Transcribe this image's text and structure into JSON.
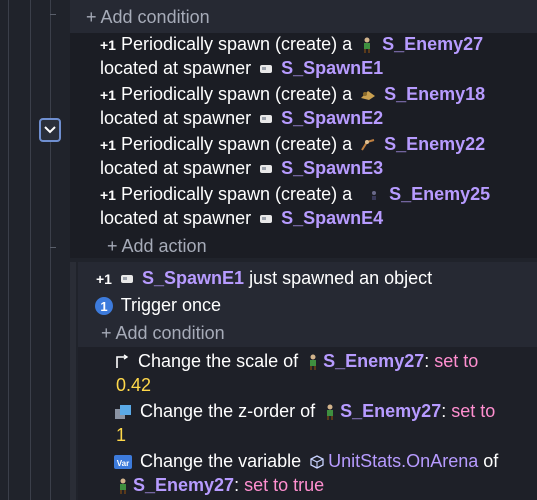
{
  "add_condition_label": "+ Add condition",
  "add_action_label": "+ Add action",
  "plus_one": "+1",
  "spawn_actions": [
    {
      "text": "Periodically spawn (create) a",
      "object": "S_Enemy27",
      "located": "located at spawner",
      "spawner": "S_SpawnE1"
    },
    {
      "text": "Periodically spawn (create) a",
      "object": "S_Enemy18",
      "located": "located at spawner",
      "spawner": "S_SpawnE2"
    },
    {
      "text": "Periodically spawn (create) a",
      "object": "S_Enemy22",
      "located": "located at spawner",
      "spawner": "S_SpawnE3"
    },
    {
      "text": "Periodically spawn (create) a",
      "object": "S_Enemy25",
      "located": "located at spawner",
      "spawner": "S_SpawnE4"
    }
  ],
  "sub_event": {
    "trigger_object": "S_SpawnE1",
    "trigger_text": "just spawned an object",
    "trigger_once_label": "Trigger once",
    "actions": [
      {
        "prefix": "Change the scale of",
        "object": "S_Enemy27",
        "colon": ":",
        "op": "set to",
        "value": "0.42"
      },
      {
        "prefix": "Change the z-order of",
        "object": "S_Enemy27",
        "colon": ":",
        "op": "set to",
        "value": "1"
      },
      {
        "prefix": "Change the variable",
        "variable": "UnitStats.OnArena",
        "of": "of",
        "object": "S_Enemy27",
        "colon": ":",
        "op": "set to true"
      }
    ]
  },
  "icons": {
    "collapse": "chevron-down-icon",
    "enemy": "enemy-sprite-icon",
    "spawner": "spawner-object-icon",
    "scale": "scale-icon",
    "zorder": "z-order-icon",
    "variable": "variable-icon",
    "trigger_once": "trigger-once-icon",
    "structure": "variable-structure-icon"
  },
  "colors": {
    "object": "#b79bff",
    "value": "#ffd84a",
    "operator": "#ff8fd0",
    "accent": "#6f8fd0"
  }
}
